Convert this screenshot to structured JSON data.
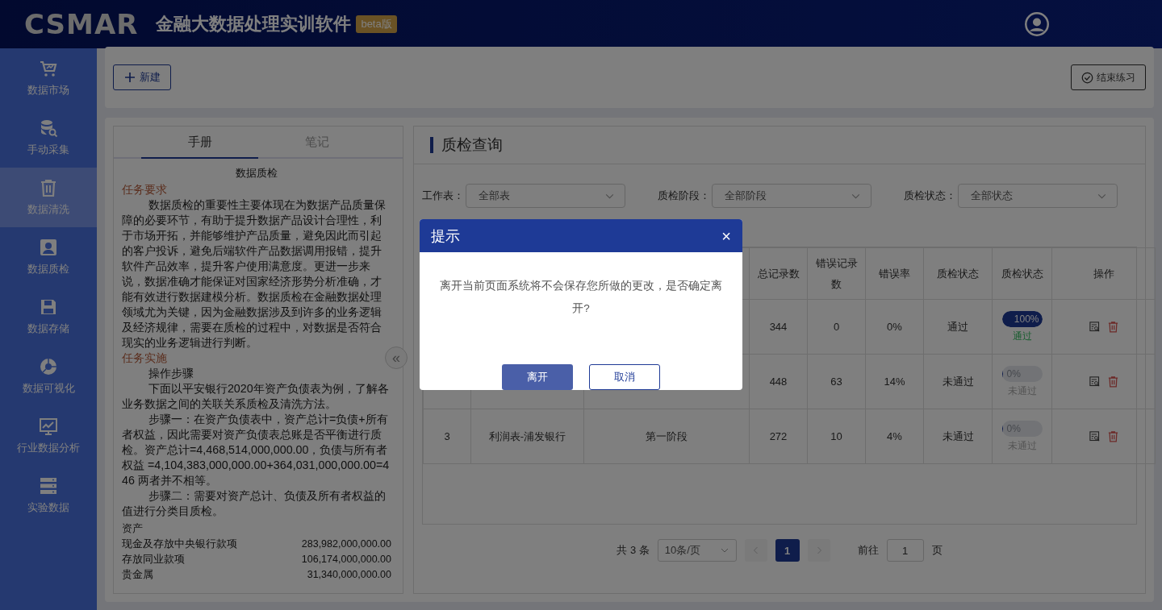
{
  "header": {
    "logo": "CSMAR",
    "title": "金融大数据处理实训软件",
    "badge": "beta版"
  },
  "sidebar": {
    "items": [
      {
        "label": "数据市场",
        "selected": false
      },
      {
        "label": "手动采集",
        "selected": false
      },
      {
        "label": "数据清洗",
        "selected": true
      },
      {
        "label": "数据质检",
        "selected": false
      },
      {
        "label": "数据存储",
        "selected": false
      },
      {
        "label": "数据可视化",
        "selected": false
      },
      {
        "label": "行业数据分析",
        "selected": false
      },
      {
        "label": "实验数据",
        "selected": false
      }
    ]
  },
  "toolbar": {
    "new_button": "新建",
    "finish_button": "结束练习"
  },
  "manual": {
    "tabs": [
      {
        "label": "手册",
        "selected": true
      },
      {
        "label": "笔记",
        "selected": false
      }
    ],
    "title": "数据质检",
    "blocks": [
      {
        "kind": "heading",
        "text": "任务要求"
      },
      {
        "kind": "para",
        "text": "数据质检的重要性主要体现在为数据产品质量保障的必要环节，有助于提升数据产品设计合理性，利于市场开拓，并能够维护产品质量，避免因此而引起的客户投诉，避免后端软件产品数据调用报错，提升软件产品效率，提升客户使用满意度。更进一步来说，数据准确才能保证对国家经济形势分析准确，才能有效进行数据建模分析。数据质检在金融数据处理领域尤为关键，因为金融数据涉及到许多的业务逻辑及经济规律，需要在质检的过程中，对数据是否符合现实的业务逻辑进行判断。"
      },
      {
        "kind": "heading",
        "text": "任务实施"
      },
      {
        "kind": "para",
        "text": "操作步骤"
      },
      {
        "kind": "para",
        "text": "下面以平安银行2020年资产负债表为例，了解各业务数据之间的关联关系质检及清洗方法。"
      },
      {
        "kind": "para",
        "text": "步骤一：在资产负债表中，资产总计=负债+所有者权益，因此需要对资产负债表总账是否平衡进行质检。资产总计=4,468,514,000,000.00，负债与所有者权益 =4,104,383,000,000.00+364,031,000,000.00=446 两者并不相等。"
      },
      {
        "kind": "para",
        "text": "步骤二：需要对资产总计、负债及所有者权益的值进行分类目质检。"
      },
      {
        "kind": "line",
        "text": "资产"
      },
      {
        "kind": "row",
        "label": "现金及存放中央银行款项",
        "value": "283,982,000,000.00"
      },
      {
        "kind": "row",
        "label": "存放同业款项",
        "value": "106,174,000,000.00"
      },
      {
        "kind": "row",
        "label": "贵金属",
        "value": "31,340,000,000.00"
      }
    ]
  },
  "collapse_button": "«",
  "qc": {
    "title": "质检查询",
    "filters": [
      {
        "label": "工作表：",
        "value": "全部表"
      },
      {
        "label": "质检阶段：",
        "value": "全部阶段"
      },
      {
        "label": "质检状态：",
        "value": "全部状态"
      }
    ],
    "table": {
      "columns": [
        "总记录数",
        "错误记录数",
        "错误率",
        "质检状态",
        "质检状态",
        "操作"
      ],
      "rows": [
        {
          "total": "344",
          "errors": "0",
          "error_rate": "0%",
          "status": "通过",
          "progress": "100%",
          "level": 1,
          "passed": true,
          "status_label": "通过"
        },
        {
          "total": "448",
          "errors": "63",
          "error_rate": "14%",
          "status": "未通过",
          "progress": "0%",
          "level": 0,
          "passed": false,
          "status_label": "未通过"
        },
        {
          "number": "3",
          "name": "利润表-浦发银行",
          "stage": "第一阶段",
          "total": "272",
          "errors": "10",
          "error_rate": "4%",
          "status": "未通过",
          "progress": "0%",
          "level": 0,
          "passed": false,
          "status_label": "未通过"
        }
      ]
    },
    "pagination": {
      "total": "共 3 条",
      "page_size": "10条/页",
      "pages": [
        {
          "label": "1",
          "selected": true
        }
      ],
      "goto_label": "前往",
      "goto_value": "1",
      "goto_suffix": "页"
    }
  },
  "dialog": {
    "title": "提示",
    "close": "×",
    "message": "离开当前页面系统将不会保存您所做的更改，是否确定离开?",
    "confirm_button": "离开",
    "cancel_button": "取消"
  }
}
